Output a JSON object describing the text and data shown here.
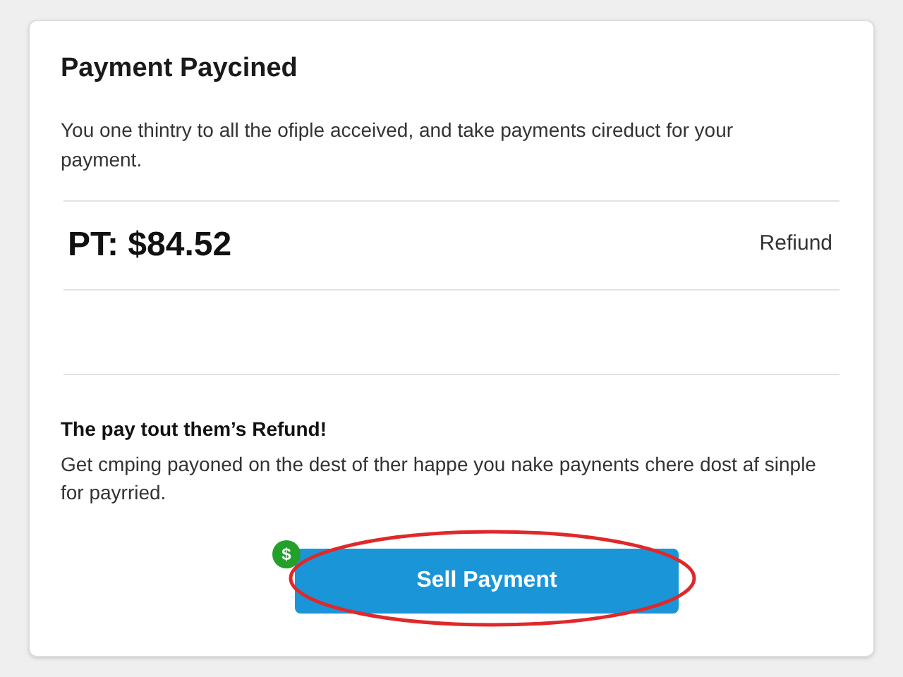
{
  "card": {
    "title": "Payment Paycined",
    "description": "You one thintry to all the ofiple acceived, and take payments cireduct for your payment.",
    "amount": "PT: $84.52",
    "amount_action": "Refiund",
    "promo_title": "The pay tout them’s Refund!",
    "promo_text": "Get cmping payoned on the dest of ther happe you nake paynents chere dost af sinple for payrried.",
    "button": {
      "label": "Sell Payment",
      "badge": "$",
      "highlighted": true
    }
  }
}
